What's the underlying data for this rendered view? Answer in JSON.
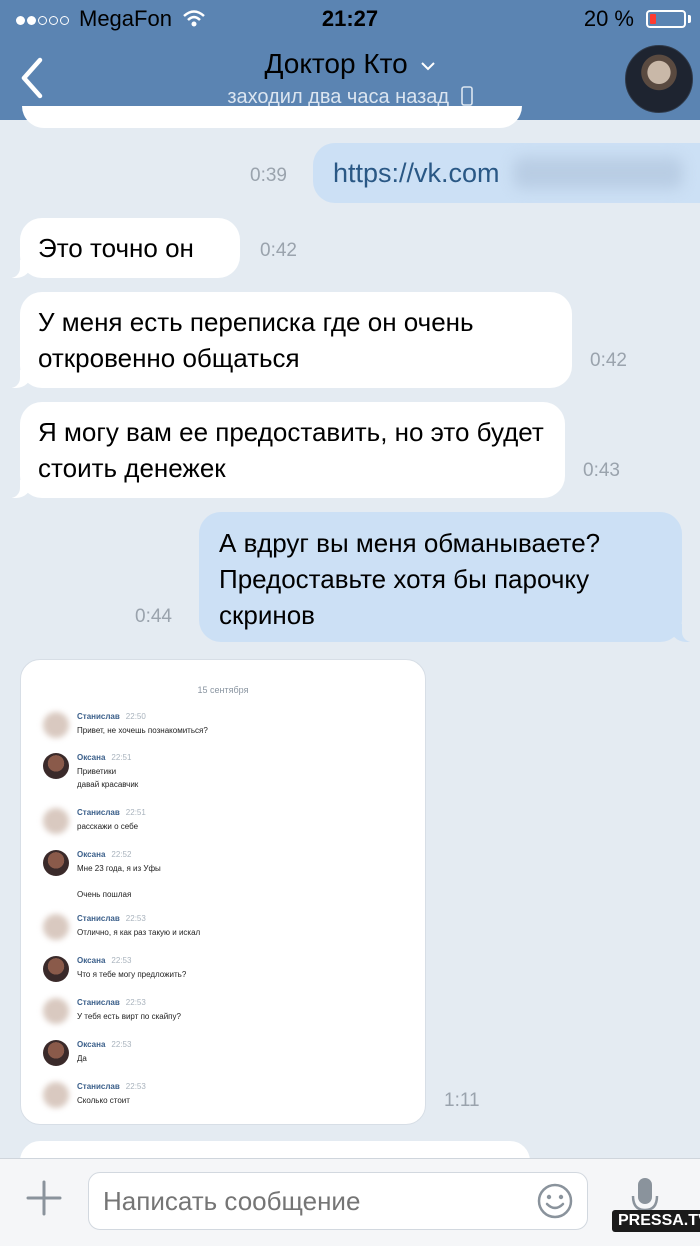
{
  "status_bar": {
    "carrier": "MegaFon",
    "time": "21:27",
    "battery_percent": "20 %",
    "battery_level": 0.2,
    "signal_bars_filled": 2,
    "signal_bars_total": 5
  },
  "header": {
    "title": "Доктор Кто",
    "subtitle": "заходил два часа назад",
    "accent_color": "#5b84b2"
  },
  "messages": [
    {
      "direction": "out",
      "text": "https://vk.com",
      "time": "0:39",
      "blurred_suffix": true
    },
    {
      "direction": "in",
      "text": "Это точно он",
      "time": "0:42"
    },
    {
      "direction": "in",
      "text": "У меня есть переписка где он очень откровенно общаться",
      "time": "0:42"
    },
    {
      "direction": "in",
      "text": "Я могу вам ее предоставить, но это будет стоить денежек",
      "time": "0:43"
    },
    {
      "direction": "out",
      "text": "А вдруг вы меня обманываете? Предоставьте хотя бы парочку скринов",
      "time": "0:44"
    },
    {
      "direction": "in",
      "type": "image",
      "time": "1:11"
    }
  ],
  "screenshot": {
    "date": "15 сентября",
    "rows": [
      {
        "name": "Станислав",
        "time": "22:50",
        "text": "Привет, не хочешь познакомиться?",
        "avatar": "blur"
      },
      {
        "name": "Оксана",
        "time": "22:51",
        "text": "Приветики\nдавай красавчик",
        "avatar": "photo"
      },
      {
        "name": "Станислав",
        "time": "22:51",
        "text": "расскажи о себе",
        "avatar": "blur"
      },
      {
        "name": "Оксана",
        "time": "22:52",
        "text": "Мне 23 года, я из Уфы\n\nОчень пошлая",
        "avatar": "photo"
      },
      {
        "name": "Станислав",
        "time": "22:53",
        "text": "Отлично, я как раз такую и искал",
        "avatar": "blur"
      },
      {
        "name": "Оксана",
        "time": "22:53",
        "text": "Что я тебе могу предложить?",
        "avatar": "photo"
      },
      {
        "name": "Станислав",
        "time": "22:53",
        "text": "У тебя есть вирт по скайпу?",
        "avatar": "blur"
      },
      {
        "name": "Оксана",
        "time": "22:53",
        "text": "Да",
        "avatar": "photo"
      },
      {
        "name": "Станислав",
        "time": "22:53",
        "text": "Сколько стоит",
        "avatar": "blur"
      }
    ]
  },
  "input": {
    "placeholder": "Написать сообщение"
  },
  "watermark": "PRESSA.TV"
}
